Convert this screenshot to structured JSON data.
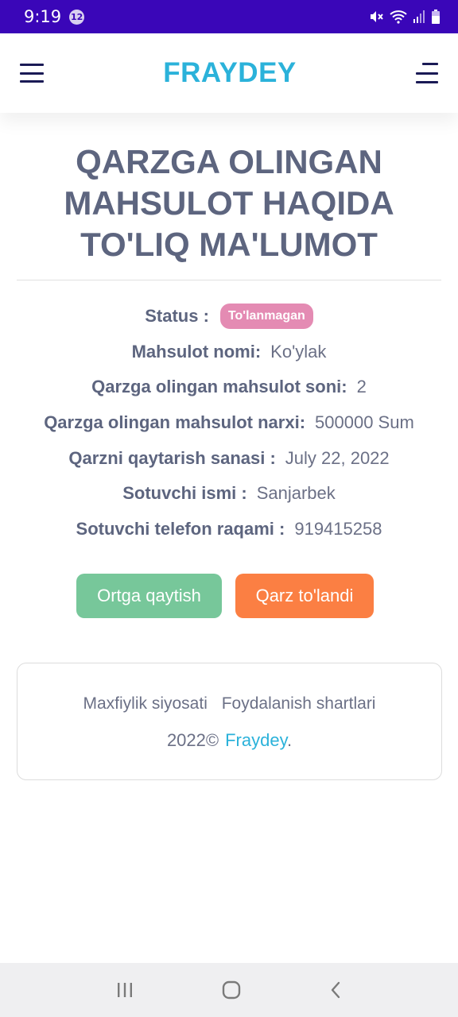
{
  "status_bar": {
    "time": "9:19",
    "notification_count": "12",
    "icons": [
      "mute-icon",
      "wifi-icon",
      "signal-icon",
      "battery-icon"
    ],
    "background": "#3a06b8"
  },
  "header": {
    "brand": "FRAYDEY",
    "brand_color": "#2bb2da",
    "left_icon": "menu-icon",
    "right_icon": "menu-icon"
  },
  "main": {
    "title": "QARZGA OLINGAN MAHSULOT HAQIDA TO'LIQ MA'LUMOT",
    "status": {
      "label": "Status :",
      "badge": "To'lanmagan",
      "badge_color": "#e48bb3"
    },
    "fields": [
      {
        "label": "Mahsulot nomi:",
        "value": "Ko'ylak"
      },
      {
        "label": "Qarzga olingan mahsulot soni:",
        "value": "2"
      },
      {
        "label": "Qarzga olingan mahsulot narxi:",
        "value": "500000 Sum"
      },
      {
        "label": "Qarzni qaytarish sanasi :",
        "value": "July 22, 2022"
      },
      {
        "label": "Sotuvchi ismi :",
        "value": "Sanjarbek"
      },
      {
        "label": "Sotuvchi telefon raqami :",
        "value": "919415258"
      }
    ],
    "buttons": {
      "back_label": "Ortga qaytish",
      "back_color": "#77c79a",
      "paid_label": "Qarz to'landi",
      "paid_color": "#fb7f43"
    }
  },
  "footer": {
    "privacy": "Maxfiylik siyosati",
    "terms": "Foydalanish shartlari",
    "copyright": "2022©",
    "brand_link": "Fraydey",
    "brand_suffix": "."
  },
  "nav_bar": {
    "icons": [
      "recent-apps-icon",
      "home-icon",
      "back-icon"
    ]
  }
}
